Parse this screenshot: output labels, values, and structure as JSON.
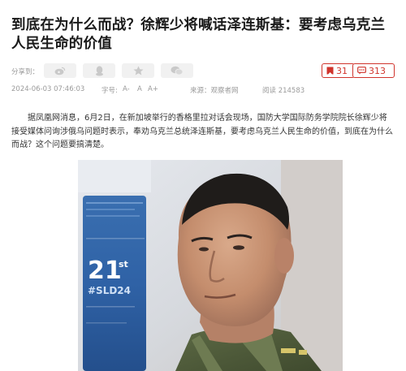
{
  "article": {
    "headline": "到底在为什么而战？徐辉少将喊话泽连斯基：要考虑乌克兰人民生命的价值",
    "share_label": "分享到：",
    "comments_count": "31",
    "views_badge": "313",
    "meta": {
      "datetime": "2024-06-03 07:46:03",
      "font_size_label": "字号:",
      "font_small": "A-",
      "font_normal": "A",
      "font_large": "A+",
      "source": "来源：观察者网",
      "reads": "阅读 214583"
    },
    "body": "据凤凰网消息，6月2日，在新加坡举行的香格里拉对话会现场，国防大学国际防务学院院长徐辉少将接受媒体问询涉俄乌问题时表示，奉劝乌克兰总统泽连斯基，要考虑乌克兰人民生命的价值，到底在为什么而战？这个问题要搞清楚。",
    "photo_sign": {
      "number": "21",
      "suffix": "st",
      "code": "#SLD24"
    }
  },
  "colors": {
    "accent_red": "#d0342c",
    "muted_text": "#9a9a9a",
    "share_icon": "#c9c9c9",
    "share_bg": "#f1f1f1"
  },
  "icons": [
    "weibo-icon",
    "qq-icon",
    "qzone-icon",
    "wechat-icon",
    "comment-icon",
    "message-icon"
  ]
}
